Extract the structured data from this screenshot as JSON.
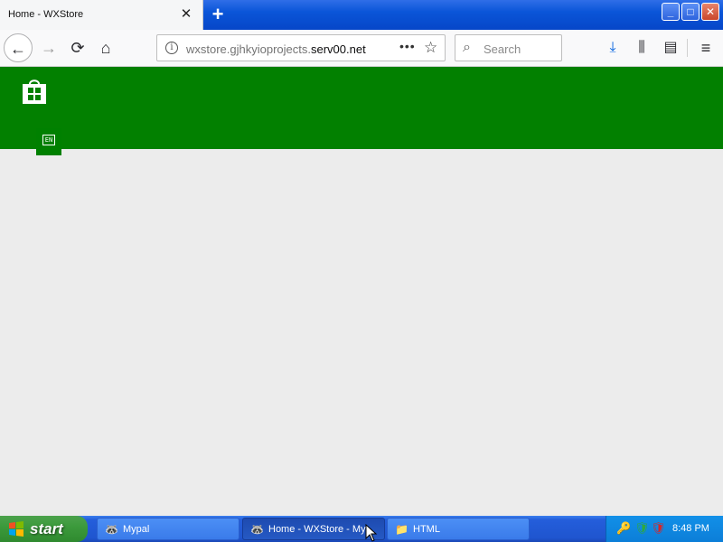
{
  "browser": {
    "tab": {
      "title": "Home - WXStore",
      "close_glyph": "✕"
    },
    "new_tab_glyph": "+",
    "window_controls": {
      "minimize": "_",
      "maximize": "□",
      "close": "✕"
    },
    "nav": {
      "back_glyph": "←",
      "forward_glyph": "→",
      "reload_glyph": "⟳",
      "home_glyph": "⌂"
    },
    "url": {
      "prefix": "wxstore.gjhkyioprojects.",
      "host": "serv00.net"
    },
    "url_more_glyph": "•••",
    "bookmark_glyph": "☆",
    "search": {
      "placeholder": "Search",
      "icon_glyph": "⌕"
    },
    "toolbar_icons": {
      "downloads": "⤓",
      "library": "⫼",
      "sidebar": "▤",
      "menu": "≡"
    }
  },
  "page": {
    "banner_color": "#028000",
    "lang_button": "EN"
  },
  "taskbar": {
    "start_label": "start",
    "tasks": [
      {
        "label": "Mypal",
        "icon": "🦝"
      },
      {
        "label": "Home - WXStore - My...",
        "icon": "🦝"
      },
      {
        "label": "HTML",
        "icon": "📁"
      }
    ],
    "tray_icons": [
      "🔑",
      "🛡",
      "🛡"
    ],
    "clock": "8:48 PM"
  },
  "colors": {
    "banner": "#028000",
    "taskbar": "#245edb",
    "start": "#3c9a3c"
  }
}
